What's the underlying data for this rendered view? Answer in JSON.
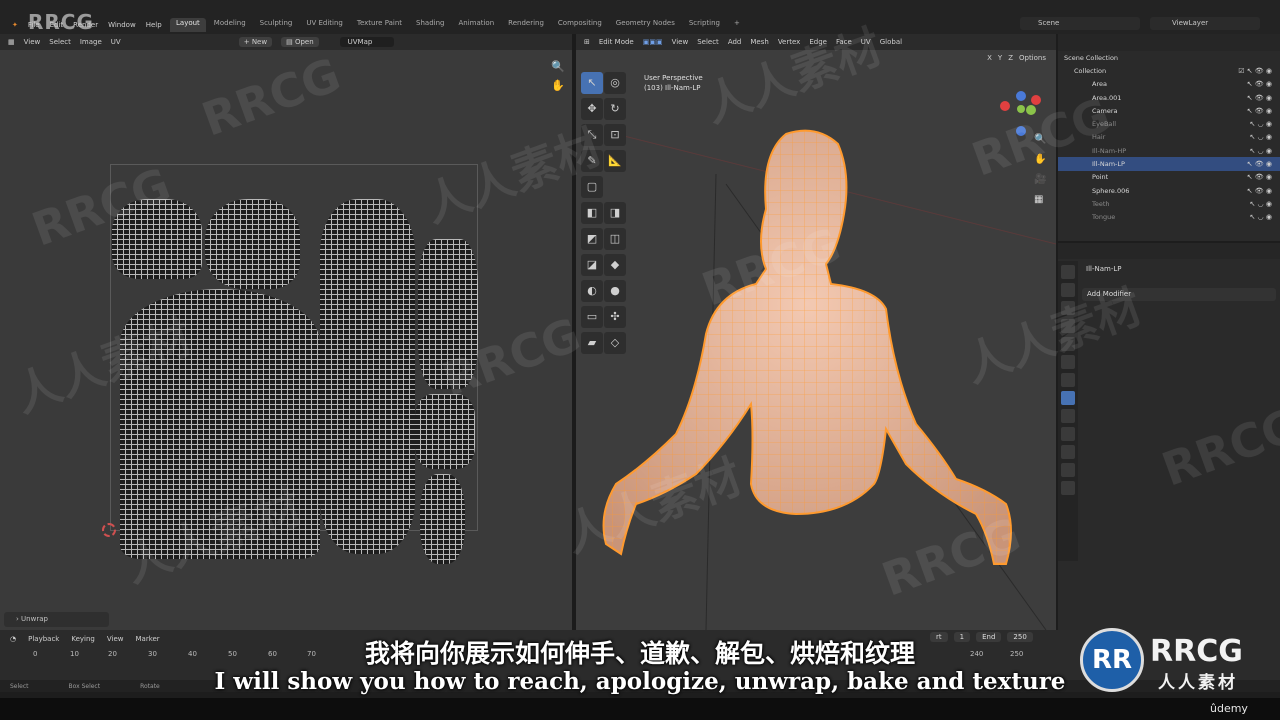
{
  "menu": [
    "File",
    "Edit",
    "Render",
    "Window",
    "Help"
  ],
  "workspace_tabs": [
    {
      "label": "Layout",
      "active": true
    },
    {
      "label": "Modeling"
    },
    {
      "label": "Sculpting"
    },
    {
      "label": "UV Editing"
    },
    {
      "label": "Texture Paint"
    },
    {
      "label": "Shading"
    },
    {
      "label": "Animation"
    },
    {
      "label": "Rendering"
    },
    {
      "label": "Compositing"
    },
    {
      "label": "Geometry Nodes"
    },
    {
      "label": "Scripting"
    }
  ],
  "scene": "Scene",
  "view_layer": "ViewLayer",
  "uv_editor": {
    "menus": [
      "View",
      "Select",
      "Image",
      "UV"
    ],
    "new_label": "New",
    "open_label": "Open",
    "uvmap": "UVMap",
    "operator_panel": "Unwrap"
  },
  "viewport": {
    "mode": "Edit Mode",
    "menus": [
      "View",
      "Select",
      "Add",
      "Mesh",
      "Vertex",
      "Edge",
      "Face",
      "UV"
    ],
    "orientation": "Global",
    "options_label": "Options",
    "axes": [
      "X",
      "Y",
      "Z"
    ],
    "perspective": "User Perspective",
    "object_info": "(103) Ill-Nam-LP"
  },
  "outliner": {
    "root": "Scene Collection",
    "collection": "Collection",
    "items": [
      {
        "name": "Area",
        "hidden": false
      },
      {
        "name": "Area.001",
        "hidden": false
      },
      {
        "name": "Camera",
        "hidden": false
      },
      {
        "name": "EyeBall",
        "hidden": true
      },
      {
        "name": "Hair",
        "hidden": true
      },
      {
        "name": "Ill-Nam-HP",
        "hidden": true
      },
      {
        "name": "Ill-Nam-LP",
        "hidden": false,
        "selected": true
      },
      {
        "name": "Point",
        "hidden": false
      },
      {
        "name": "Sphere.006",
        "hidden": false
      },
      {
        "name": "Teeth",
        "hidden": true
      },
      {
        "name": "Tongue",
        "hidden": true
      }
    ]
  },
  "properties": {
    "object": "Ill-Nam-LP",
    "add_modifier": "Add Modifier"
  },
  "timeline": {
    "menus": [
      "Playback",
      "Keying",
      "View",
      "Marker"
    ],
    "ticks": [
      "0",
      "10",
      "20",
      "30",
      "40",
      "50",
      "60",
      "70",
      "240",
      "250"
    ],
    "start_label": "rt",
    "start": "1",
    "end_label": "End",
    "end": "250"
  },
  "statusbar": [
    "Select",
    "Box Select",
    "Rotate"
  ],
  "subtitles": {
    "chinese": "我将向你展示如何伸手、道歉、解包、烘焙和纹理",
    "english": "I will show you how to reach, apologize, unwrap, bake and texture"
  },
  "branding": {
    "logo_tl": "RRCG",
    "logo_br": "RRCG",
    "logo_br_sub": "人人素材",
    "udemy": "ûdemy",
    "watermark_en": "RRCG",
    "watermark_cn": "人人素材"
  },
  "colors": {
    "accent": "#4772b3",
    "mesh_orange": "#ff9a2e",
    "skin": "#e8b49a",
    "logo_blue": "#1e5fa8"
  }
}
